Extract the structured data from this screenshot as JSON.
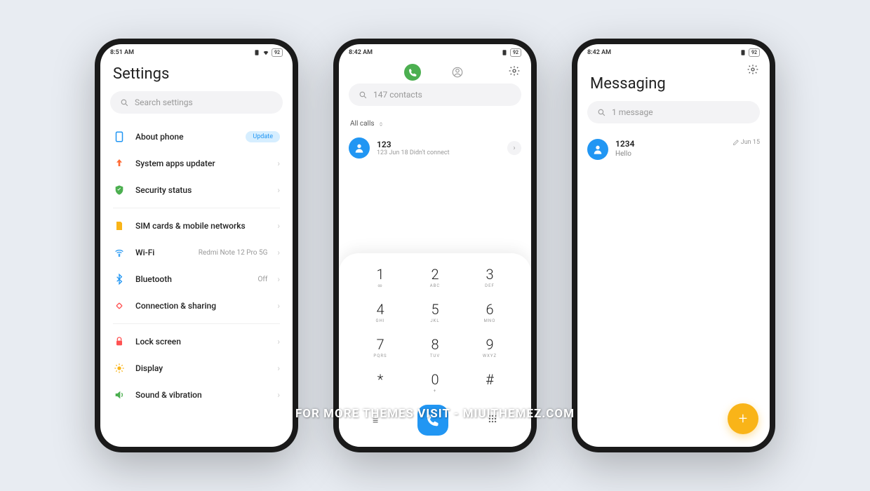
{
  "watermark": "FOR MORE THEMES VISIT - MIUITHEMEZ.COM",
  "phone1": {
    "time": "8:51 AM",
    "battery": "92",
    "title": "Settings",
    "search_placeholder": "Search settings",
    "items": [
      {
        "label": "About phone",
        "badge": "Update"
      },
      {
        "label": "System apps updater"
      },
      {
        "label": "Security status"
      },
      {
        "label": "SIM cards & mobile networks"
      },
      {
        "label": "Wi-Fi",
        "value": "Redmi Note 12 Pro 5G"
      },
      {
        "label": "Bluetooth",
        "value": "Off"
      },
      {
        "label": "Connection & sharing"
      },
      {
        "label": "Lock screen"
      },
      {
        "label": "Display"
      },
      {
        "label": "Sound & vibration"
      }
    ]
  },
  "phone2": {
    "time": "8:42 AM",
    "battery": "92",
    "search_placeholder": "147 contacts",
    "filter": "All calls",
    "call": {
      "name": "123",
      "sub": "123  Jun 18 Didn't connect"
    },
    "keys": [
      {
        "n": "1",
        "l": "∞"
      },
      {
        "n": "2",
        "l": "ABC"
      },
      {
        "n": "3",
        "l": "DEF"
      },
      {
        "n": "4",
        "l": "GHI"
      },
      {
        "n": "5",
        "l": "JKL"
      },
      {
        "n": "6",
        "l": "MNO"
      },
      {
        "n": "7",
        "l": "PQRS"
      },
      {
        "n": "8",
        "l": "TUV"
      },
      {
        "n": "9",
        "l": "WXYZ"
      },
      {
        "n": "*",
        "l": ""
      },
      {
        "n": "0",
        "l": "+"
      },
      {
        "n": "#",
        "l": ""
      }
    ]
  },
  "phone3": {
    "time": "8:42 AM",
    "battery": "92",
    "title": "Messaging",
    "search_placeholder": "1 message",
    "msg": {
      "name": "1234",
      "text": "Hello",
      "date": "Jun 15"
    }
  }
}
